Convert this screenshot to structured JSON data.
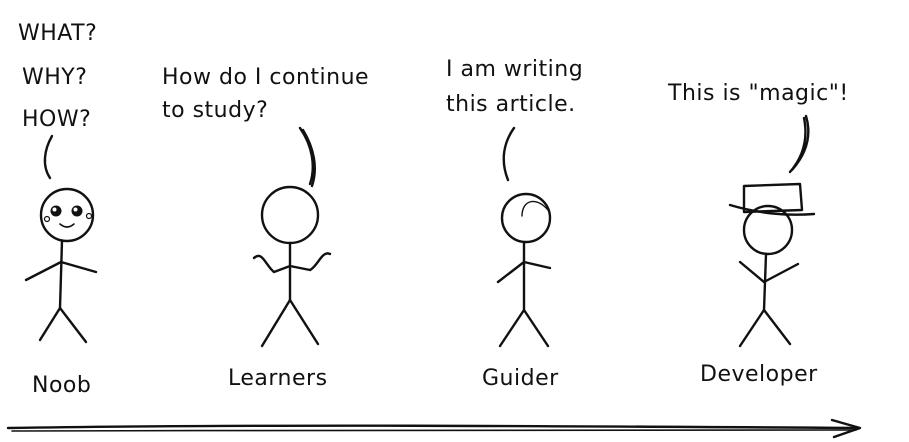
{
  "colors": {
    "ink": "#111111",
    "background": "#ffffff"
  },
  "speech": {
    "noob": [
      "WHAT?",
      "WHY?",
      "HOW?"
    ],
    "learners": [
      "How do I continue",
      "to study?"
    ],
    "guider": [
      "I am writing",
      "this article."
    ],
    "developer": [
      "This is \"magic\"!"
    ]
  },
  "labels": {
    "noob": "Noob",
    "learners": "Learners",
    "guider": "Guider",
    "developer": "Developer"
  }
}
